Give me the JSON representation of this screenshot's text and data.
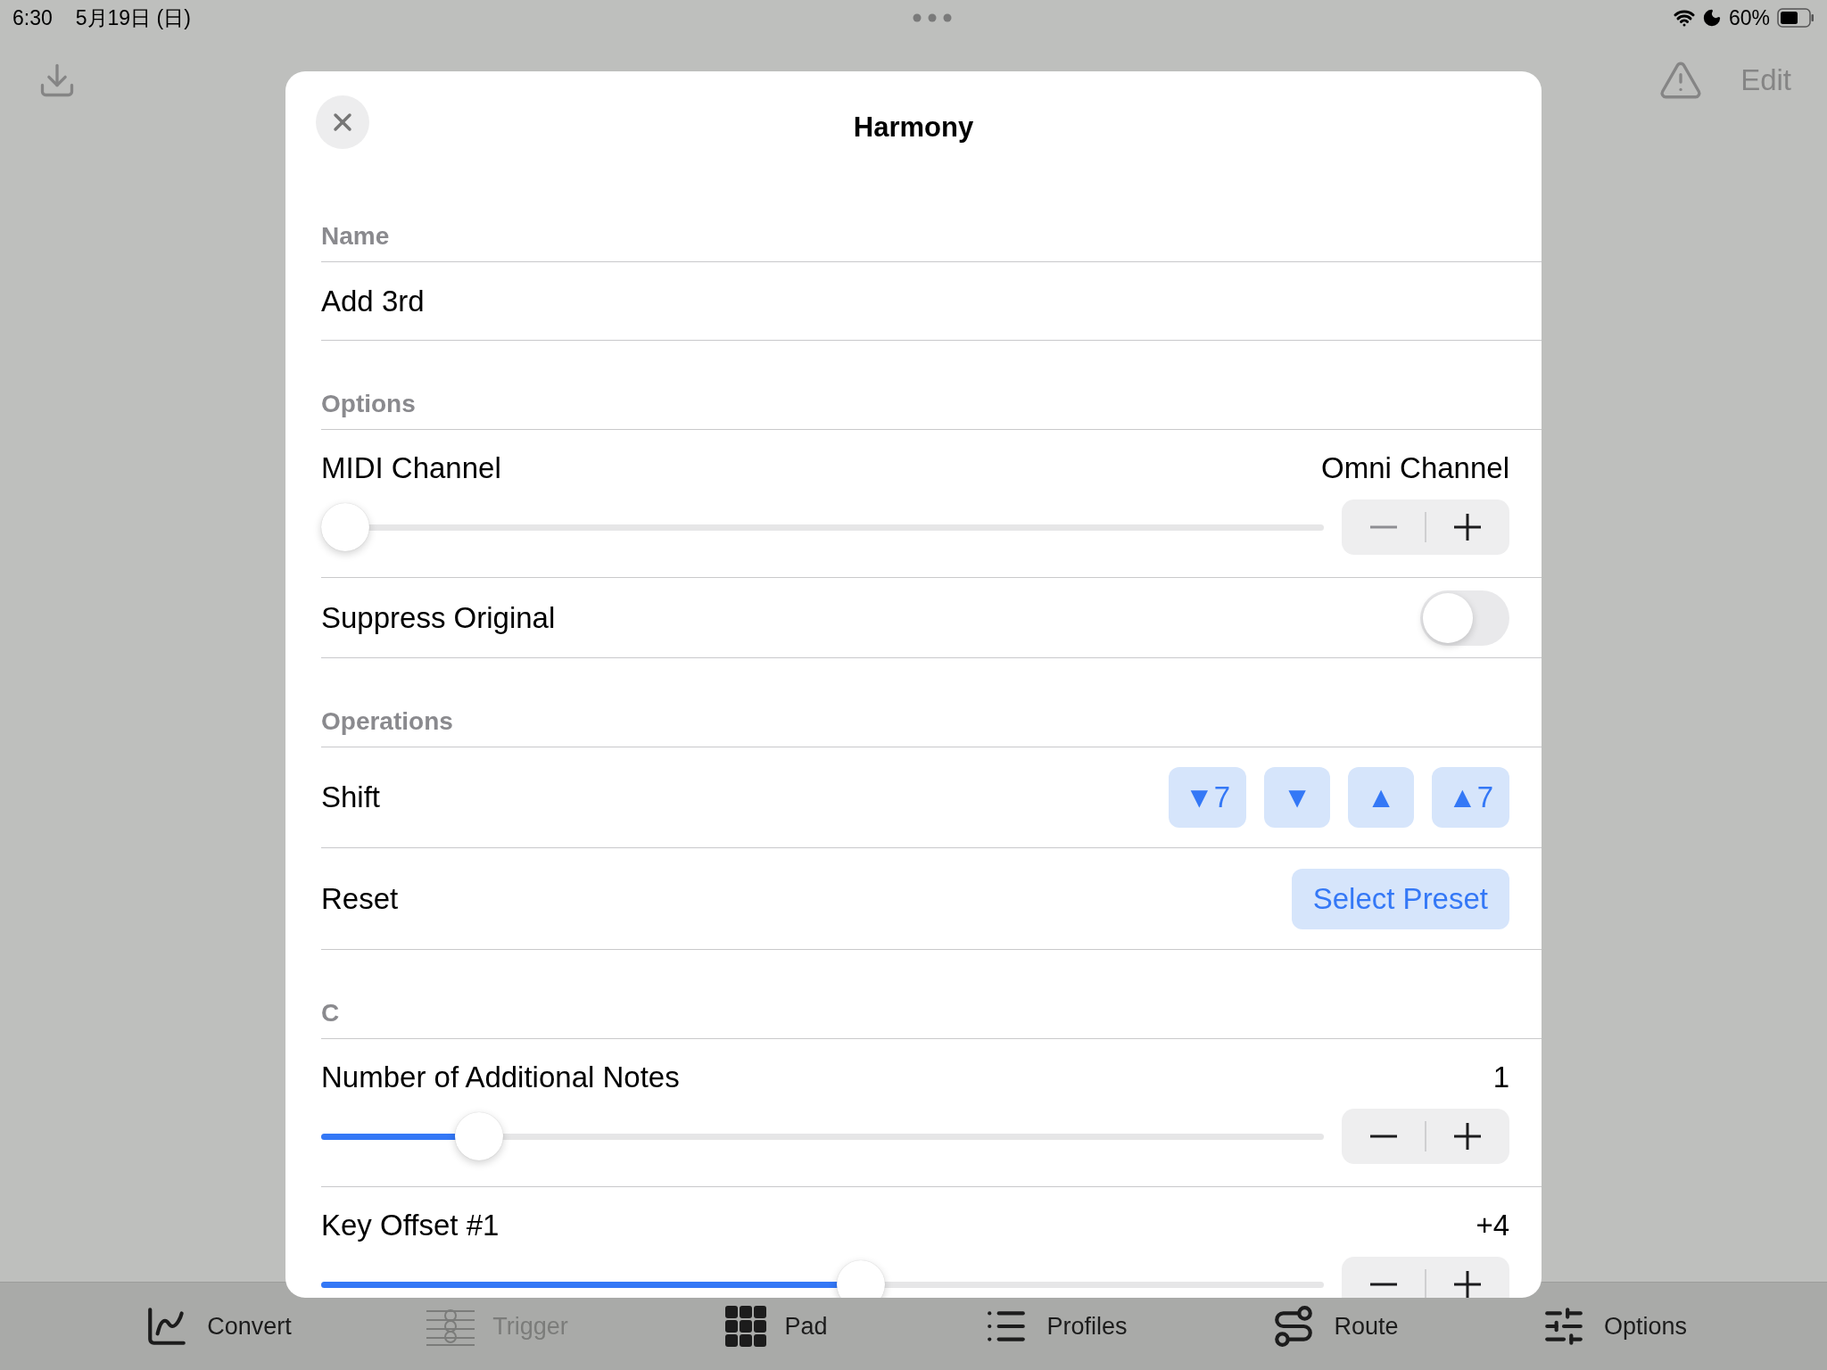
{
  "status_bar": {
    "time": "6:30",
    "date": "5月19日 (日)",
    "battery": "60%"
  },
  "nav_bar": {
    "edit": "Edit"
  },
  "sheet": {
    "title": "Harmony",
    "sections": [
      {
        "header": "Name",
        "rows": [
          {
            "kind": "text",
            "value": "Add 3rd"
          }
        ]
      },
      {
        "header": "Options",
        "rows": [
          {
            "kind": "slider",
            "label": "MIDI Channel",
            "reading": "Omni Channel",
            "level": 0,
            "minus_disabled": true
          },
          {
            "kind": "toggle",
            "label": "Suppress Original",
            "on": false
          }
        ]
      },
      {
        "header": "Operations",
        "rows": [
          {
            "kind": "buttons",
            "label": "Shift",
            "buttons": [
              "▼7",
              "▼",
              "▲",
              "▲7"
            ]
          },
          {
            "kind": "button",
            "label": "Reset",
            "button": "Select Preset"
          }
        ]
      },
      {
        "header": "C",
        "rows": [
          {
            "kind": "slider",
            "label": "Number of Additional Notes",
            "reading": "1",
            "level": 0.14,
            "minus_disabled": false
          },
          {
            "kind": "slider",
            "label": "Key Offset #1",
            "reading": "+4",
            "level": 0.54,
            "minus_disabled": false
          }
        ]
      }
    ]
  },
  "tab_bar": [
    {
      "label": "Convert",
      "disabled": false
    },
    {
      "label": "Trigger",
      "disabled": true
    },
    {
      "label": "Pad",
      "disabled": false
    },
    {
      "label": "Profiles",
      "disabled": false
    },
    {
      "label": "Route",
      "disabled": false
    },
    {
      "label": "Options",
      "disabled": false
    }
  ]
}
